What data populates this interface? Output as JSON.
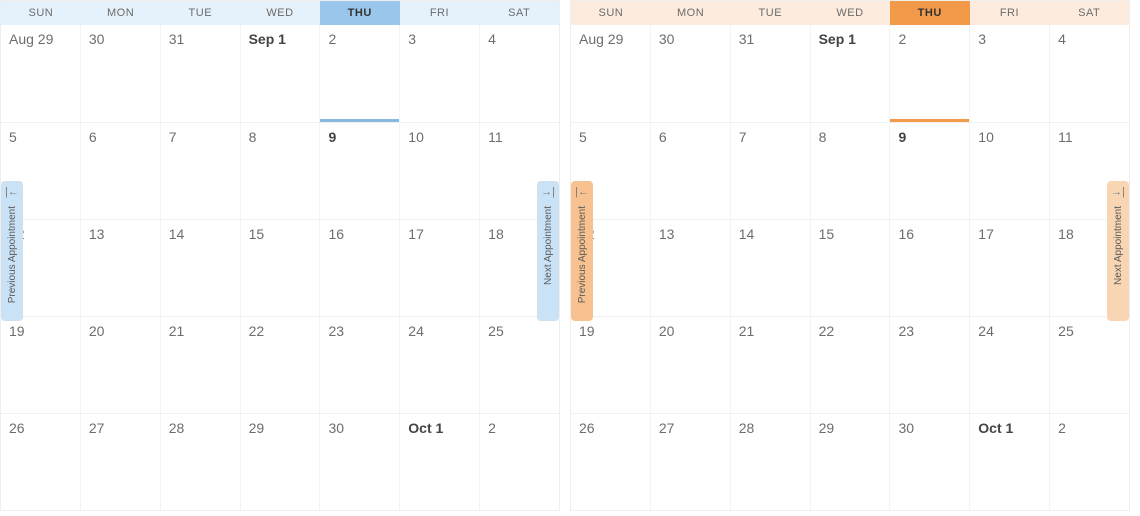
{
  "calendars": [
    {
      "theme": "blue",
      "headers": [
        "SUN",
        "MON",
        "TUE",
        "WED",
        "THU",
        "FRI",
        "SAT"
      ],
      "todayHeaderIndex": 4,
      "prevLabel": "Previous Appointment",
      "nextLabel": "Next Appointment",
      "prevArrow": "|←",
      "nextArrow": "→|",
      "weeks": [
        [
          {
            "label": "Aug 29",
            "bold": false,
            "todayLine": false
          },
          {
            "label": "30",
            "bold": false,
            "todayLine": false
          },
          {
            "label": "31",
            "bold": false,
            "todayLine": false
          },
          {
            "label": "Sep 1",
            "bold": true,
            "todayLine": false
          },
          {
            "label": "2",
            "bold": false,
            "todayLine": true
          },
          {
            "label": "3",
            "bold": false,
            "todayLine": false
          },
          {
            "label": "4",
            "bold": false,
            "todayLine": false
          }
        ],
        [
          {
            "label": "5",
            "bold": false,
            "todayLine": false
          },
          {
            "label": "6",
            "bold": false,
            "todayLine": false
          },
          {
            "label": "7",
            "bold": false,
            "todayLine": false
          },
          {
            "label": "8",
            "bold": false,
            "todayLine": false
          },
          {
            "label": "9",
            "bold": true,
            "todayLine": false
          },
          {
            "label": "10",
            "bold": false,
            "todayLine": false
          },
          {
            "label": "11",
            "bold": false,
            "todayLine": false
          }
        ],
        [
          {
            "label": "12",
            "bold": false,
            "todayLine": false
          },
          {
            "label": "13",
            "bold": false,
            "todayLine": false
          },
          {
            "label": "14",
            "bold": false,
            "todayLine": false
          },
          {
            "label": "15",
            "bold": false,
            "todayLine": false
          },
          {
            "label": "16",
            "bold": false,
            "todayLine": false
          },
          {
            "label": "17",
            "bold": false,
            "todayLine": false
          },
          {
            "label": "18",
            "bold": false,
            "todayLine": false
          }
        ],
        [
          {
            "label": "19",
            "bold": false,
            "todayLine": false
          },
          {
            "label": "20",
            "bold": false,
            "todayLine": false
          },
          {
            "label": "21",
            "bold": false,
            "todayLine": false
          },
          {
            "label": "22",
            "bold": false,
            "todayLine": false
          },
          {
            "label": "23",
            "bold": false,
            "todayLine": false
          },
          {
            "label": "24",
            "bold": false,
            "todayLine": false
          },
          {
            "label": "25",
            "bold": false,
            "todayLine": false
          }
        ],
        [
          {
            "label": "26",
            "bold": false,
            "todayLine": false
          },
          {
            "label": "27",
            "bold": false,
            "todayLine": false
          },
          {
            "label": "28",
            "bold": false,
            "todayLine": false
          },
          {
            "label": "29",
            "bold": false,
            "todayLine": false
          },
          {
            "label": "30",
            "bold": false,
            "todayLine": false
          },
          {
            "label": "Oct 1",
            "bold": true,
            "todayLine": false
          },
          {
            "label": "2",
            "bold": false,
            "todayLine": false
          }
        ]
      ]
    },
    {
      "theme": "orange",
      "headers": [
        "SUN",
        "MON",
        "TUE",
        "WED",
        "THU",
        "FRI",
        "SAT"
      ],
      "todayHeaderIndex": 4,
      "prevLabel": "Previous Appointment",
      "nextLabel": "Next Appointment",
      "prevArrow": "|←",
      "nextArrow": "→|",
      "weeks": [
        [
          {
            "label": "Aug 29",
            "bold": false,
            "todayLine": false
          },
          {
            "label": "30",
            "bold": false,
            "todayLine": false
          },
          {
            "label": "31",
            "bold": false,
            "todayLine": false
          },
          {
            "label": "Sep 1",
            "bold": true,
            "todayLine": false
          },
          {
            "label": "2",
            "bold": false,
            "todayLine": true
          },
          {
            "label": "3",
            "bold": false,
            "todayLine": false
          },
          {
            "label": "4",
            "bold": false,
            "todayLine": false
          }
        ],
        [
          {
            "label": "5",
            "bold": false,
            "todayLine": false
          },
          {
            "label": "6",
            "bold": false,
            "todayLine": false
          },
          {
            "label": "7",
            "bold": false,
            "todayLine": false
          },
          {
            "label": "8",
            "bold": false,
            "todayLine": false
          },
          {
            "label": "9",
            "bold": true,
            "todayLine": false
          },
          {
            "label": "10",
            "bold": false,
            "todayLine": false
          },
          {
            "label": "11",
            "bold": false,
            "todayLine": false
          }
        ],
        [
          {
            "label": "12",
            "bold": false,
            "todayLine": false
          },
          {
            "label": "13",
            "bold": false,
            "todayLine": false
          },
          {
            "label": "14",
            "bold": false,
            "todayLine": false
          },
          {
            "label": "15",
            "bold": false,
            "todayLine": false
          },
          {
            "label": "16",
            "bold": false,
            "todayLine": false
          },
          {
            "label": "17",
            "bold": false,
            "todayLine": false
          },
          {
            "label": "18",
            "bold": false,
            "todayLine": false
          }
        ],
        [
          {
            "label": "19",
            "bold": false,
            "todayLine": false
          },
          {
            "label": "20",
            "bold": false,
            "todayLine": false
          },
          {
            "label": "21",
            "bold": false,
            "todayLine": false
          },
          {
            "label": "22",
            "bold": false,
            "todayLine": false
          },
          {
            "label": "23",
            "bold": false,
            "todayLine": false
          },
          {
            "label": "24",
            "bold": false,
            "todayLine": false
          },
          {
            "label": "25",
            "bold": false,
            "todayLine": false
          }
        ],
        [
          {
            "label": "26",
            "bold": false,
            "todayLine": false
          },
          {
            "label": "27",
            "bold": false,
            "todayLine": false
          },
          {
            "label": "28",
            "bold": false,
            "todayLine": false
          },
          {
            "label": "29",
            "bold": false,
            "todayLine": false
          },
          {
            "label": "30",
            "bold": false,
            "todayLine": false
          },
          {
            "label": "Oct 1",
            "bold": true,
            "todayLine": false
          },
          {
            "label": "2",
            "bold": false,
            "todayLine": false
          }
        ]
      ]
    }
  ]
}
